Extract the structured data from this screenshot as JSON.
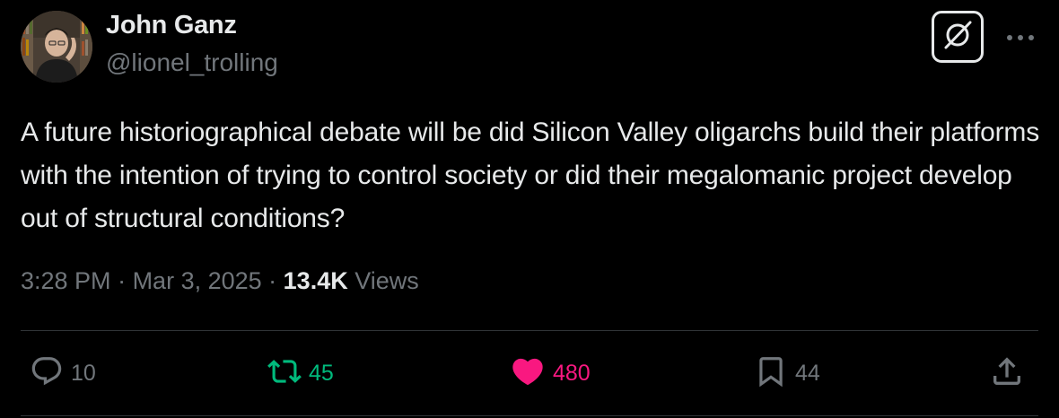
{
  "author": {
    "name": "John Ganz",
    "handle": "@lionel_trolling"
  },
  "tweet": {
    "text": "A future historiographical debate will be did Silicon Valley oligarchs build their platforms with the intention of trying to control society or did their megalomanic project develop out of structural conditions?"
  },
  "meta": {
    "time": "3:28 PM",
    "separator": " · ",
    "date": "Mar 3, 2025",
    "views_count": "13.4K",
    "views_label": "Views"
  },
  "actions": {
    "reply_count": "10",
    "retweet_count": "45",
    "like_count": "480",
    "bookmark_count": "44"
  },
  "icons": {
    "grok": "grok-icon",
    "more": "more-dots-icon",
    "reply": "reply-icon",
    "retweet": "retweet-icon",
    "like": "heart-icon",
    "bookmark": "bookmark-icon",
    "share": "share-icon"
  },
  "colors": {
    "background": "#000000",
    "text_primary": "#e7e9ea",
    "text_secondary": "#71767b",
    "retweet_active": "#00ba7c",
    "like_active": "#f91880",
    "divider": "#2f3336"
  }
}
